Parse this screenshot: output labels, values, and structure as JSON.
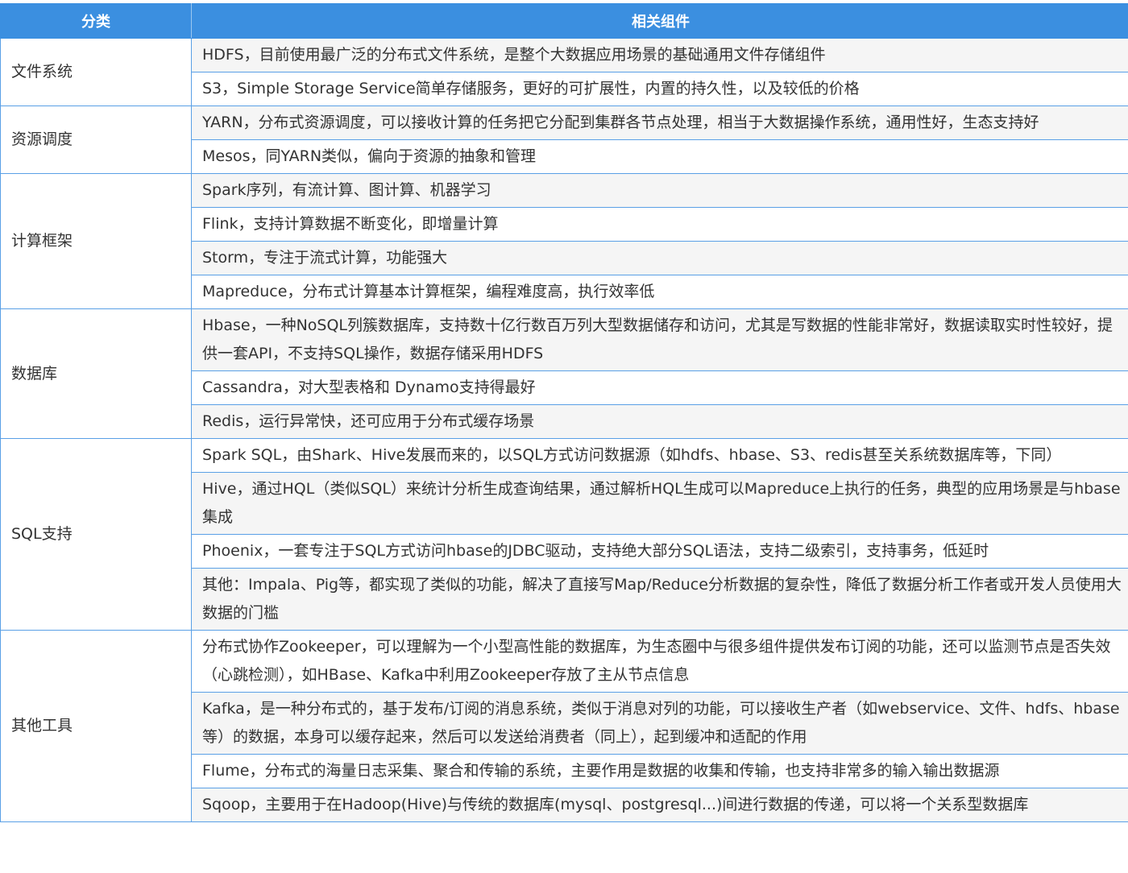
{
  "header": {
    "col_category": "分类",
    "col_components": "相关组件"
  },
  "groups": [
    {
      "category": "文件系统",
      "items": [
        "HDFS，目前使用最广泛的分布式文件系统，是整个大数据应用场景的基础通用文件存储组件",
        "S3，Simple Storage Service简单存储服务，更好的可扩展性，内置的持久性，以及较低的价格"
      ]
    },
    {
      "category": "资源调度",
      "items": [
        "YARN，分布式资源调度，可以接收计算的任务把它分配到集群各节点处理，相当于大数据操作系统，通用性好，生态支持好",
        "Mesos，同YARN类似，偏向于资源的抽象和管理"
      ]
    },
    {
      "category": "计算框架",
      "items": [
        "Spark序列，有流计算、图计算、机器学习",
        "Flink，支持计算数据不断变化，即增量计算",
        "Storm，专注于流式计算，功能强大",
        "Mapreduce，分布式计算基本计算框架，编程难度高，执行效率低"
      ]
    },
    {
      "category": "数据库",
      "items": [
        "Hbase，一种NoSQL列簇数据库，支持数十亿行数百万列大型数据储存和访问，尤其是写数据的性能非常好，数据读取实时性较好，提供一套API，不支持SQL操作，数据存储采用HDFS",
        "Cassandra，对大型表格和 Dynamo支持得最好",
        "Redis，运行异常快，还可应用于分布式缓存场景"
      ]
    },
    {
      "category": "SQL支持",
      "items": [
        "Spark SQL，由Shark、Hive发展而来的，以SQL方式访问数据源（如hdfs、hbase、S3、redis甚至关系统数据库等，下同）",
        "Hive，通过HQL（类似SQL）来统计分析生成查询结果，通过解析HQL生成可以Mapreduce上执行的任务，典型的应用场景是与hbase集成",
        "Phoenix，一套专注于SQL方式访问hbase的JDBC驱动，支持绝大部分SQL语法，支持二级索引，支持事务，低延时",
        "其他：Impala、Pig等，都实现了类似的功能，解决了直接写Map/Reduce分析数据的复杂性，降低了数据分析工作者或开发人员使用大数据的门槛"
      ]
    },
    {
      "category": "其他工具",
      "items": [
        "分布式协作Zookeeper，可以理解为一个小型高性能的数据库，为生态圈中与很多组件提供发布订阅的功能，还可以监测节点是否失效（心跳检测），如HBase、Kafka中利用Zookeeper存放了主从节点信息",
        "Kafka，是一种分布式的，基于发布/订阅的消息系统，类似于消息对列的功能，可以接收生产者（如webservice、文件、hdfs、hbase等）的数据，本身可以缓存起来，然后可以发送给消费者（同上），起到缓冲和适配的作用",
        "Flume，分布式的海量日志采集、聚合和传输的系统，主要作用是数据的收集和传输，也支持非常多的输入输出数据源",
        "Sqoop，主要用于在Hadoop(Hive)与传统的数据库(mysql、postgresql...)间进行数据的传递，可以将一个关系型数据库"
      ]
    }
  ]
}
